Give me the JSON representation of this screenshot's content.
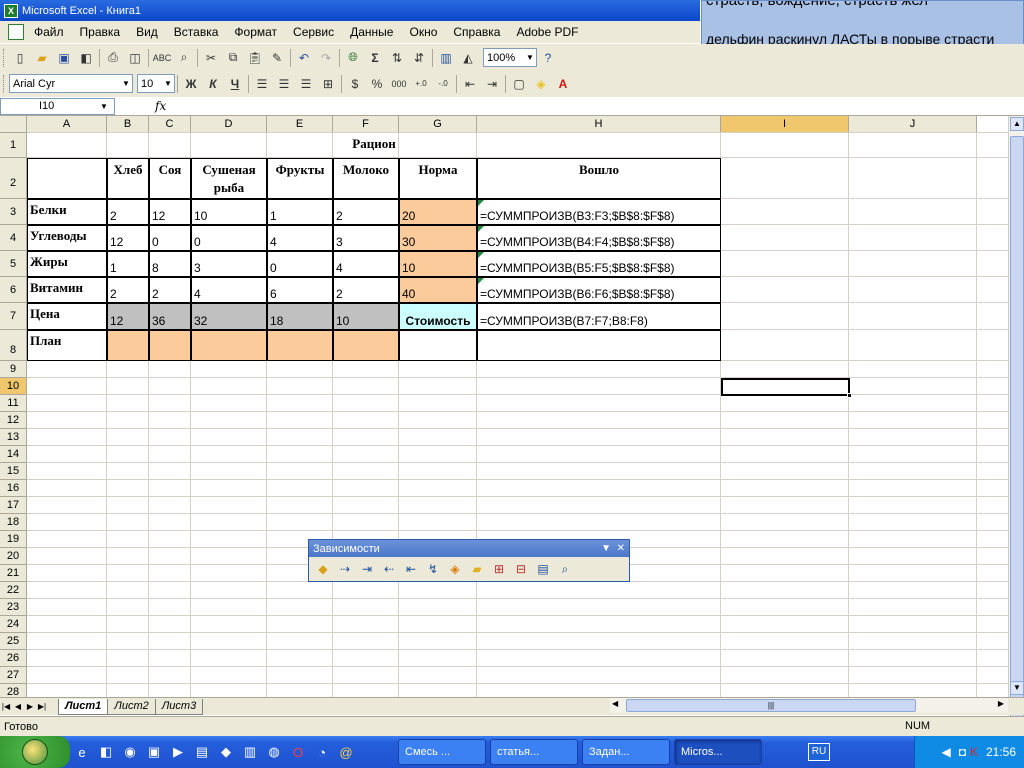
{
  "window": {
    "title": "Microsoft Excel - Книга1"
  },
  "overlay": {
    "line1": "страсть, вождение, страсть жел",
    "line2": "дельфин раскинул ЛАСТы в порыве страсти"
  },
  "menu": [
    "Файл",
    "Правка",
    "Вид",
    "Вставка",
    "Формат",
    "Сервис",
    "Данные",
    "Окно",
    "Справка",
    "Adobe PDF"
  ],
  "toolbar": {
    "zoom": "100%",
    "font_name": "Arial Cyr",
    "font_size": "10",
    "bold": "Ж",
    "italic": "К",
    "underline": "Ч",
    "percent": "%",
    "thousands": "000"
  },
  "formula_bar": {
    "name_box": "I10",
    "fx": "fx",
    "content": ""
  },
  "columns": [
    "A",
    "B",
    "C",
    "D",
    "E",
    "F",
    "G",
    "H",
    "I",
    "J"
  ],
  "rows": [
    "1",
    "2",
    "3",
    "4",
    "5",
    "6",
    "7",
    "8",
    "9",
    "10",
    "11",
    "12",
    "13",
    "14",
    "15",
    "16",
    "17",
    "18",
    "19",
    "20",
    "21",
    "22",
    "23",
    "24",
    "25",
    "26",
    "27",
    "28"
  ],
  "sheet": {
    "title": "Рацион",
    "headers": [
      "Хлеб",
      "Соя",
      "Сушеная рыба",
      "Фрукты",
      "Молоко",
      "Норма",
      "Вошло"
    ],
    "table": [
      {
        "label": "Белки",
        "values": [
          "2",
          "12",
          "10",
          "1",
          "2"
        ],
        "norm": "20",
        "formula": "=СУММПРОИЗВ(B3:F3;$B$8:$F$8)"
      },
      {
        "label": "Углеводы",
        "values": [
          "12",
          "0",
          "0",
          "4",
          "3"
        ],
        "norm": "30",
        "formula": "=СУММПРОИЗВ(B4:F4;$B$8:$F$8)"
      },
      {
        "label": "Жиры",
        "values": [
          "1",
          "8",
          "3",
          "0",
          "4"
        ],
        "norm": "10",
        "formula": "=СУММПРОИЗВ(B5:F5;$B$8:$F$8)"
      },
      {
        "label": "Витамин",
        "values": [
          "2",
          "2",
          "4",
          "6",
          "2"
        ],
        "norm": "40",
        "formula": "=СУММПРОИЗВ(B6:F6;$B$8:$F$8)"
      }
    ],
    "price": {
      "label": "Цена",
      "values": [
        "12",
        "36",
        "32",
        "18",
        "10"
      ],
      "cost_label": "Стоимость",
      "formula": "=СУММПРОИЗВ(B7:F7;B8:F8)"
    },
    "plan": {
      "label": "План"
    },
    "colors": {
      "orange": "#fbcb9c",
      "gray": "#c0c0c0",
      "cyan": "#ccffff"
    }
  },
  "tabs": [
    "Лист1",
    "Лист2",
    "Лист3"
  ],
  "status": {
    "ready": "Готово",
    "num": "NUM"
  },
  "dependencies_toolbar": {
    "title": "Зависимости"
  },
  "taskbar": {
    "tasks": [
      "Смесь ...",
      "статья...",
      "Задан...",
      "Micros..."
    ],
    "lang": "RU",
    "clock": "21:56"
  }
}
